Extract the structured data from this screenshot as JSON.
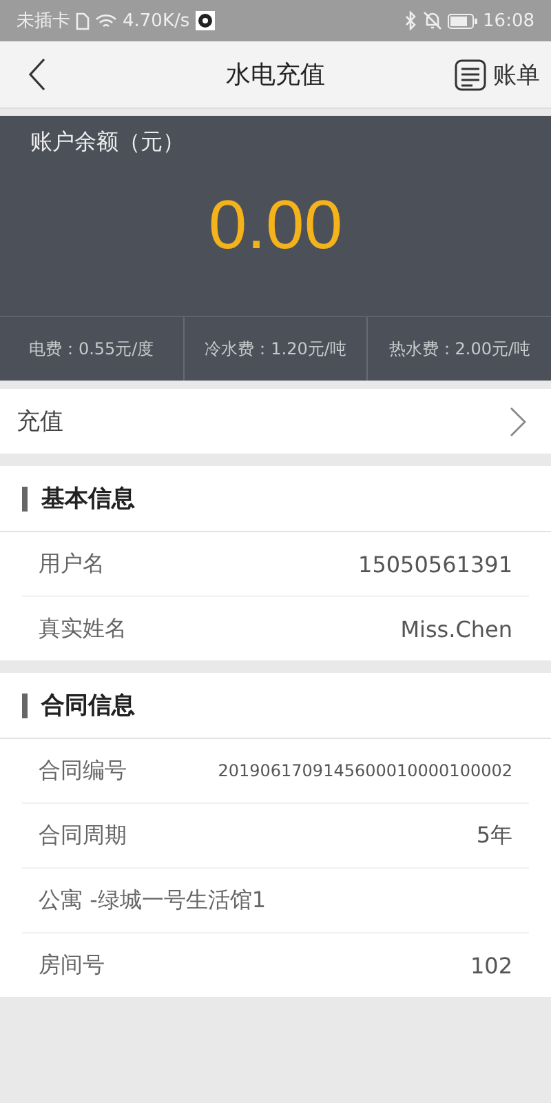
{
  "status_bar": {
    "carrier": "未插卡",
    "speed": "4.70K/s",
    "time": "16:08"
  },
  "nav": {
    "title": "水电充值",
    "bill": "账单"
  },
  "balance": {
    "label": "账户余额（元）",
    "amount": "0.00",
    "fees": [
      "电费：0.55元/度",
      "冷水费：1.20元/吨",
      "热水费：2.00元/吨"
    ]
  },
  "recharge": {
    "label": "充值"
  },
  "sections": [
    {
      "title": "基本信息",
      "rows": [
        {
          "label": "用户名",
          "value": "15050561391"
        },
        {
          "label": "真实姓名",
          "value": "Miss.Chen"
        }
      ]
    },
    {
      "title": "合同信息",
      "rows": [
        {
          "label": "合同编号",
          "value": "2019061709145600010000100002",
          "small": true
        },
        {
          "label": "合同周期",
          "value": "5年"
        },
        {
          "label": "公寓 -绿城一号生活馆1"
        },
        {
          "label": "房间号",
          "value": "102"
        }
      ]
    }
  ]
}
